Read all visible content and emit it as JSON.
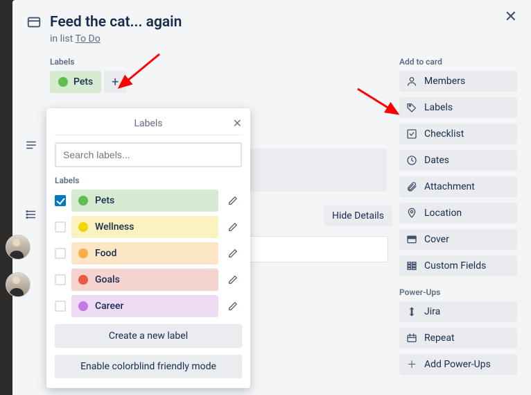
{
  "card": {
    "title": "Feed the cat... again",
    "in_list_prefix": "in list ",
    "list_name": "To Do"
  },
  "labels_section": {
    "heading": "Labels",
    "applied": [
      {
        "name": "Pets",
        "bg": "#d6ecd2",
        "dot": "#61bd4f"
      }
    ],
    "add_tooltip": "+"
  },
  "popover": {
    "title": "Labels",
    "search_placeholder": "Search labels...",
    "section_label": "Labels",
    "items": [
      {
        "name": "Pets",
        "bg": "#d6ecd2",
        "dot": "#61bd4f",
        "checked": true
      },
      {
        "name": "Wellness",
        "bg": "#faf3c0",
        "dot": "#f2d600",
        "checked": false
      },
      {
        "name": "Food",
        "bg": "#fce6c6",
        "dot": "#ffab4a",
        "checked": false
      },
      {
        "name": "Goals",
        "bg": "#f5d3ce",
        "dot": "#eb5a46",
        "checked": false
      },
      {
        "name": "Career",
        "bg": "#eddbf4",
        "dot": "#c377e0",
        "checked": false
      }
    ],
    "create_label": "Create a new label",
    "colorblind_label": "Enable colorblind friendly mode"
  },
  "hide_details": "Hide Details",
  "sidebar": {
    "add_heading": "Add to card",
    "add_items": [
      {
        "key": "members",
        "label": "Members",
        "icon": "user"
      },
      {
        "key": "labels",
        "label": "Labels",
        "icon": "tag"
      },
      {
        "key": "checklist",
        "label": "Checklist",
        "icon": "check"
      },
      {
        "key": "dates",
        "label": "Dates",
        "icon": "clock"
      },
      {
        "key": "attachment",
        "label": "Attachment",
        "icon": "paperclip"
      },
      {
        "key": "location",
        "label": "Location",
        "icon": "pin"
      },
      {
        "key": "cover",
        "label": "Cover",
        "icon": "cover"
      },
      {
        "key": "customfields",
        "label": "Custom Fields",
        "icon": "fields"
      }
    ],
    "powerups_heading": "Power-Ups",
    "powerups": [
      {
        "key": "jira",
        "label": "Jira",
        "icon": "jira"
      },
      {
        "key": "repeat",
        "label": "Repeat",
        "icon": "repeat"
      }
    ],
    "add_powerups": "Add Power-Ups"
  }
}
